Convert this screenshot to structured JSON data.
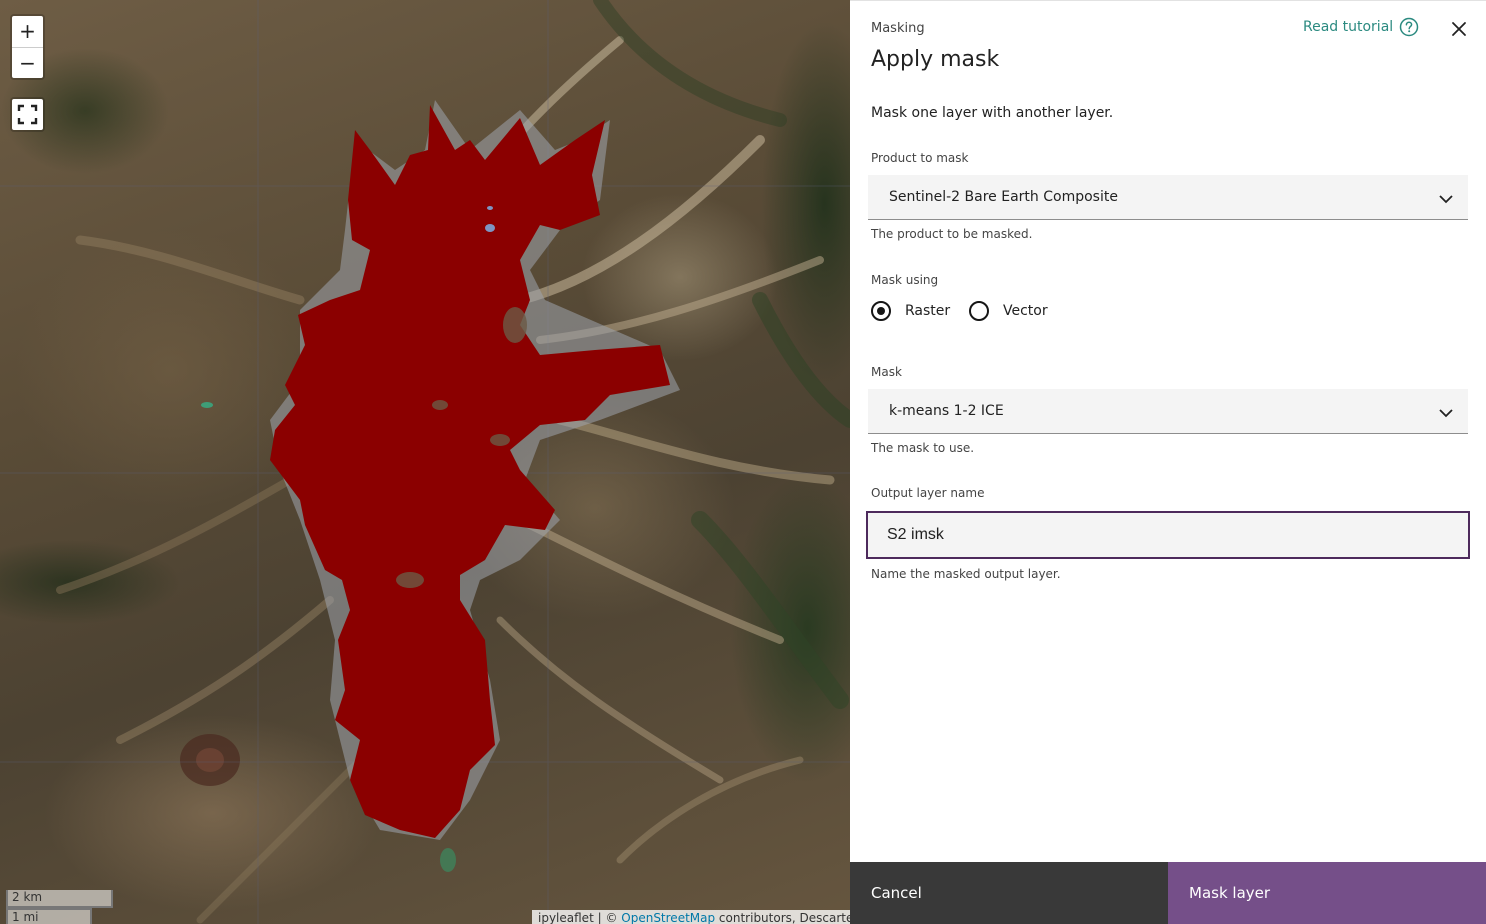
{
  "map": {
    "controls": {
      "zoom_in_label": "+",
      "zoom_out_label": "−"
    },
    "scale": {
      "km": "2 km",
      "mi": "1 mi"
    },
    "attribution": {
      "prefix": "ipyleaflet | © ",
      "link": "OpenStreetMap",
      "suffix": " contributors, Descartes"
    },
    "mask_color": "#8b0000"
  },
  "panel": {
    "eyebrow": "Masking",
    "title": "Apply mask",
    "tutorial_label": "Read tutorial",
    "description": "Mask one layer with another layer.",
    "product": {
      "label": "Product to mask",
      "value": "Sentinel-2 Bare Earth Composite",
      "helper": "The product to be masked."
    },
    "mask_using": {
      "label": "Mask using",
      "options": [
        "Raster",
        "Vector"
      ],
      "selected": "Raster"
    },
    "mask": {
      "label": "Mask",
      "value": "k-means 1-2 ICE",
      "helper": "The mask to use."
    },
    "output": {
      "label": "Output layer name",
      "value": "S2 imsk",
      "helper": "Name the masked output layer."
    },
    "footer": {
      "cancel": "Cancel",
      "submit": "Mask layer"
    }
  },
  "colors": {
    "accent": "#754f89",
    "link": "#2b8a80",
    "cancel_bg": "#393939"
  }
}
